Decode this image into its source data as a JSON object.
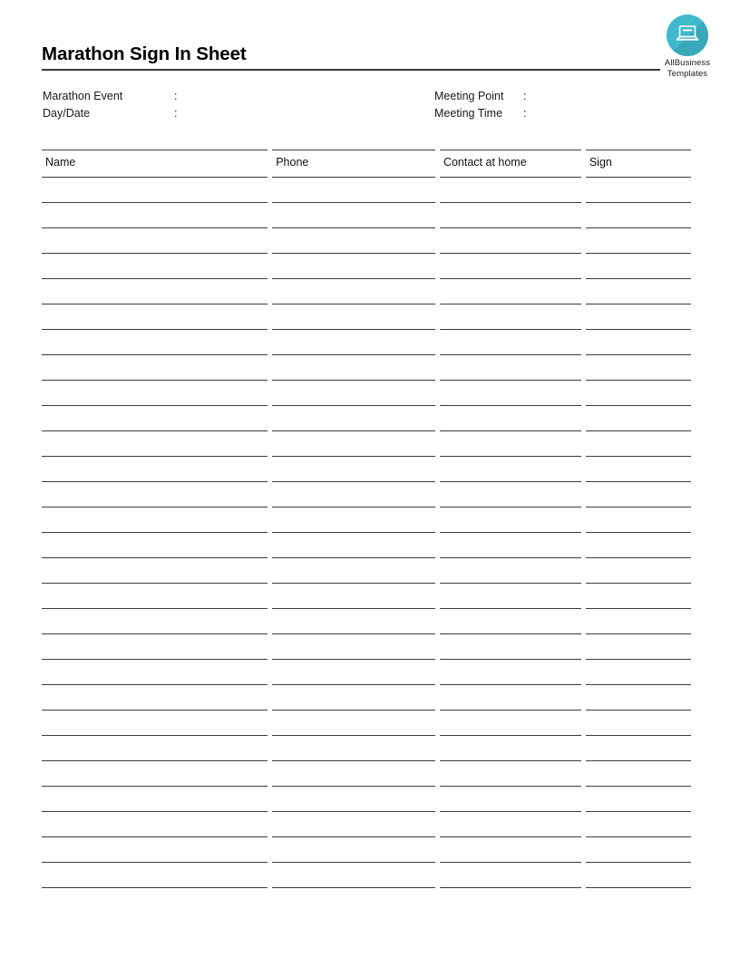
{
  "document": {
    "title": "Marathon Sign In Sheet"
  },
  "logo": {
    "icon": "laptop-icon",
    "line1": "AllBusiness",
    "line2": "Templates",
    "circle_color": "#3fb9cd",
    "icon_color": "#ffffff"
  },
  "meta": {
    "left": [
      {
        "label": "Marathon Event",
        "colon": ":",
        "value": ""
      },
      {
        "label": "Day/Date",
        "colon": ":",
        "value": ""
      }
    ],
    "right": [
      {
        "label": "Meeting Point",
        "colon": ":",
        "value": ""
      },
      {
        "label": "Meeting Time",
        "colon": ":",
        "value": ""
      }
    ]
  },
  "table": {
    "columns": [
      {
        "key": "name",
        "header": "Name"
      },
      {
        "key": "phone",
        "header": "Phone"
      },
      {
        "key": "contact",
        "header": "Contact at home"
      },
      {
        "key": "sign",
        "header": "Sign"
      }
    ],
    "row_count": 28,
    "rows": [
      {
        "name": "",
        "phone": "",
        "contact": "",
        "sign": ""
      },
      {
        "name": "",
        "phone": "",
        "contact": "",
        "sign": ""
      },
      {
        "name": "",
        "phone": "",
        "contact": "",
        "sign": ""
      },
      {
        "name": "",
        "phone": "",
        "contact": "",
        "sign": ""
      },
      {
        "name": "",
        "phone": "",
        "contact": "",
        "sign": ""
      },
      {
        "name": "",
        "phone": "",
        "contact": "",
        "sign": ""
      },
      {
        "name": "",
        "phone": "",
        "contact": "",
        "sign": ""
      },
      {
        "name": "",
        "phone": "",
        "contact": "",
        "sign": ""
      },
      {
        "name": "",
        "phone": "",
        "contact": "",
        "sign": ""
      },
      {
        "name": "",
        "phone": "",
        "contact": "",
        "sign": ""
      },
      {
        "name": "",
        "phone": "",
        "contact": "",
        "sign": ""
      },
      {
        "name": "",
        "phone": "",
        "contact": "",
        "sign": ""
      },
      {
        "name": "",
        "phone": "",
        "contact": "",
        "sign": ""
      },
      {
        "name": "",
        "phone": "",
        "contact": "",
        "sign": ""
      },
      {
        "name": "",
        "phone": "",
        "contact": "",
        "sign": ""
      },
      {
        "name": "",
        "phone": "",
        "contact": "",
        "sign": ""
      },
      {
        "name": "",
        "phone": "",
        "contact": "",
        "sign": ""
      },
      {
        "name": "",
        "phone": "",
        "contact": "",
        "sign": ""
      },
      {
        "name": "",
        "phone": "",
        "contact": "",
        "sign": ""
      },
      {
        "name": "",
        "phone": "",
        "contact": "",
        "sign": ""
      },
      {
        "name": "",
        "phone": "",
        "contact": "",
        "sign": ""
      },
      {
        "name": "",
        "phone": "",
        "contact": "",
        "sign": ""
      },
      {
        "name": "",
        "phone": "",
        "contact": "",
        "sign": ""
      },
      {
        "name": "",
        "phone": "",
        "contact": "",
        "sign": ""
      },
      {
        "name": "",
        "phone": "",
        "contact": "",
        "sign": ""
      },
      {
        "name": "",
        "phone": "",
        "contact": "",
        "sign": ""
      },
      {
        "name": "",
        "phone": "",
        "contact": "",
        "sign": ""
      },
      {
        "name": "",
        "phone": "",
        "contact": "",
        "sign": ""
      }
    ]
  },
  "colors": {
    "rule": "#3c3c3c",
    "text": "#111111",
    "page_background": "#ffffff"
  }
}
